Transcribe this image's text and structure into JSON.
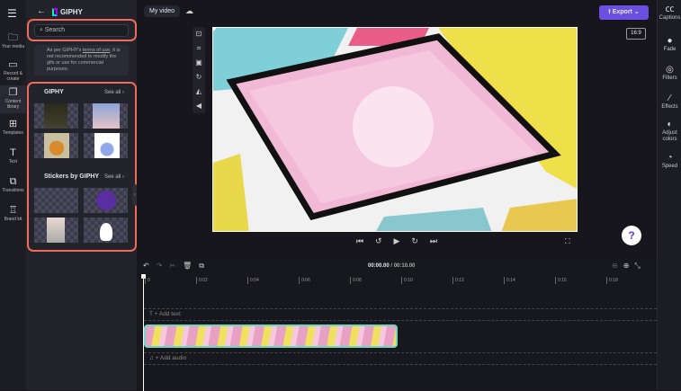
{
  "rail": {
    "items": [
      {
        "label": "Your media",
        "icon": "folder-icon"
      },
      {
        "label": "Record & create",
        "icon": "camera-icon"
      },
      {
        "label": "Content library",
        "icon": "library-icon"
      },
      {
        "label": "Templates",
        "icon": "templates-icon"
      },
      {
        "label": "Text",
        "icon": "text-icon"
      },
      {
        "label": "Transitions",
        "icon": "transitions-icon"
      },
      {
        "label": "Brand kit",
        "icon": "brand-kit-icon"
      }
    ]
  },
  "panel": {
    "title": "GIPHY",
    "search_placeholder": "Search",
    "notice_pre": "As per GIPHY's ",
    "notice_link": "terms of use",
    "notice_post": ", it is not recommended to modify the gifs or use for commercial purposes.",
    "sections": [
      {
        "title": "GIPHY",
        "see_all": "See all"
      },
      {
        "title": "Stickers by GIPHY",
        "see_all": "See all"
      }
    ]
  },
  "header": {
    "project_name": "My video",
    "export_label": "Export",
    "aspect_ratio": "16:9",
    "help": "?"
  },
  "right_rail": {
    "items": [
      {
        "label": "Captions",
        "icon": "captions-icon"
      },
      {
        "label": "Fade",
        "icon": "fade-icon"
      },
      {
        "label": "Filters",
        "icon": "filters-icon"
      },
      {
        "label": "Effects",
        "icon": "effects-icon"
      },
      {
        "label": "Adjust colors",
        "icon": "adjust-colors-icon"
      },
      {
        "label": "Speed",
        "icon": "speed-icon"
      }
    ]
  },
  "timeline": {
    "current": "00:00.00",
    "total": "/ 00:10.00",
    "ticks": [
      "0",
      "0:02",
      "0:04",
      "0:06",
      "0:08",
      "0:10",
      "0:12",
      "0:14",
      "0:16",
      "0:18"
    ],
    "add_text": "+ Add text",
    "add_audio": "+ Add audio"
  },
  "colors": {
    "accent": "#6b4fe0",
    "highlight": "#ef6b5d",
    "clip_border": "#6fd6c2"
  }
}
